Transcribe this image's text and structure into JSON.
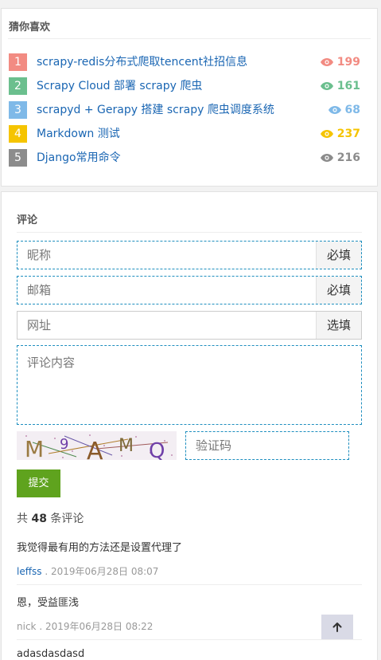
{
  "guess": {
    "title": "猜你喜欢",
    "items": [
      {
        "rank": "1",
        "title": "scrapy-redis分布式爬取tencent社招信息",
        "views": "199",
        "color": "#f28b82"
      },
      {
        "rank": "2",
        "title": "Scrapy Cloud 部署 scrapy 爬虫",
        "views": "161",
        "color": "#6bbf8e"
      },
      {
        "rank": "3",
        "title": "scrapyd + Gerapy 搭建 scrapy 爬虫调度系统",
        "views": "68",
        "color": "#7fb9e8"
      },
      {
        "rank": "4",
        "title": "Markdown 测试",
        "views": "237",
        "color": "#f5c400"
      },
      {
        "rank": "5",
        "title": "Django常用命令",
        "views": "216",
        "color": "#8c8c8c"
      }
    ]
  },
  "comment_form": {
    "title": "评论",
    "nickname_placeholder": "昵称",
    "nickname_addon": "必填",
    "email_placeholder": "邮箱",
    "email_addon": "必填",
    "website_placeholder": "网址",
    "website_addon": "选填",
    "content_placeholder": "评论内容",
    "captcha_text": "M9AMQ",
    "captcha_placeholder": "验证码",
    "submit_label": "提交"
  },
  "comments_summary": {
    "prefix": "共",
    "count": "48",
    "suffix": "条评论"
  },
  "comments": [
    {
      "text": "我觉得最有用的方法还是设置代理了",
      "author": "leffss",
      "separator": " . ",
      "time": "2019年06月28日 08:07"
    },
    {
      "text": "恩，受益匪浅",
      "author": "nick",
      "separator": " . ",
      "time": "2019年06月28日 08:22"
    },
    {
      "text": "adasdasdasd",
      "author": "",
      "separator": "",
      "time": ""
    }
  ]
}
